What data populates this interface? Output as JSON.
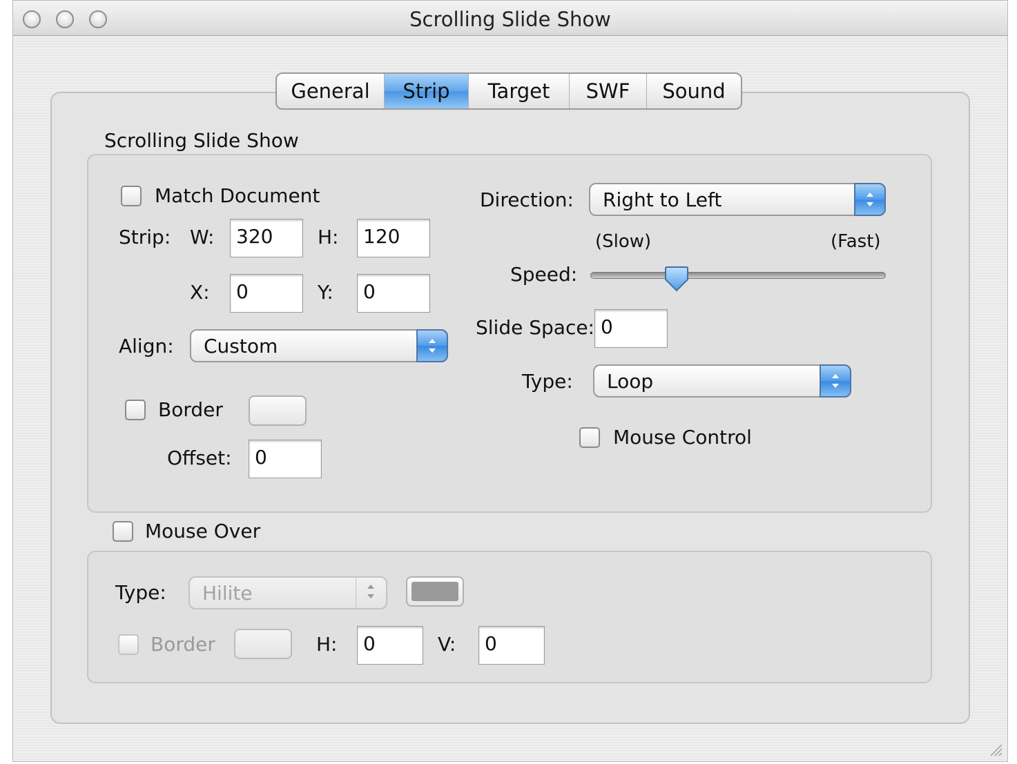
{
  "window": {
    "title": "Scrolling Slide Show"
  },
  "tabs": [
    {
      "label": "General",
      "selected": false
    },
    {
      "label": "Strip",
      "selected": true
    },
    {
      "label": "Target",
      "selected": false
    },
    {
      "label": "SWF",
      "selected": false
    },
    {
      "label": "Sound",
      "selected": false
    }
  ],
  "strip_group": {
    "heading": "Scrolling Slide Show",
    "match_document": {
      "label": "Match Document",
      "checked": false
    },
    "strip_label": "Strip:",
    "w_label": "W:",
    "w_value": "320",
    "h_label": "H:",
    "h_value": "120",
    "x_label": "X:",
    "x_value": "0",
    "y_label": "Y:",
    "y_value": "0",
    "align_label": "Align:",
    "align_value": "Custom",
    "border": {
      "label": "Border",
      "checked": false
    },
    "offset_label": "Offset:",
    "offset_value": "0",
    "direction_label": "Direction:",
    "direction_value": "Right to Left",
    "slow_label": "(Slow)",
    "fast_label": "(Fast)",
    "speed_label": "Speed:",
    "speed_value": 0.27,
    "slide_space_label": "Slide Space:",
    "slide_space_value": "0",
    "type_label": "Type:",
    "type_value": "Loop",
    "mouse_control": {
      "label": "Mouse Control",
      "checked": false
    }
  },
  "mouse_over_group": {
    "heading": {
      "label": "Mouse Over",
      "checked": false
    },
    "type_label": "Type:",
    "type_value": "Hilite",
    "border": {
      "label": "Border",
      "checked": false
    },
    "h_label": "H:",
    "h_value": "0",
    "v_label": "V:",
    "v_value": "0"
  },
  "colors": {
    "accent": "#4e9ceb",
    "disabled_swatch": "#9a9a9a"
  }
}
